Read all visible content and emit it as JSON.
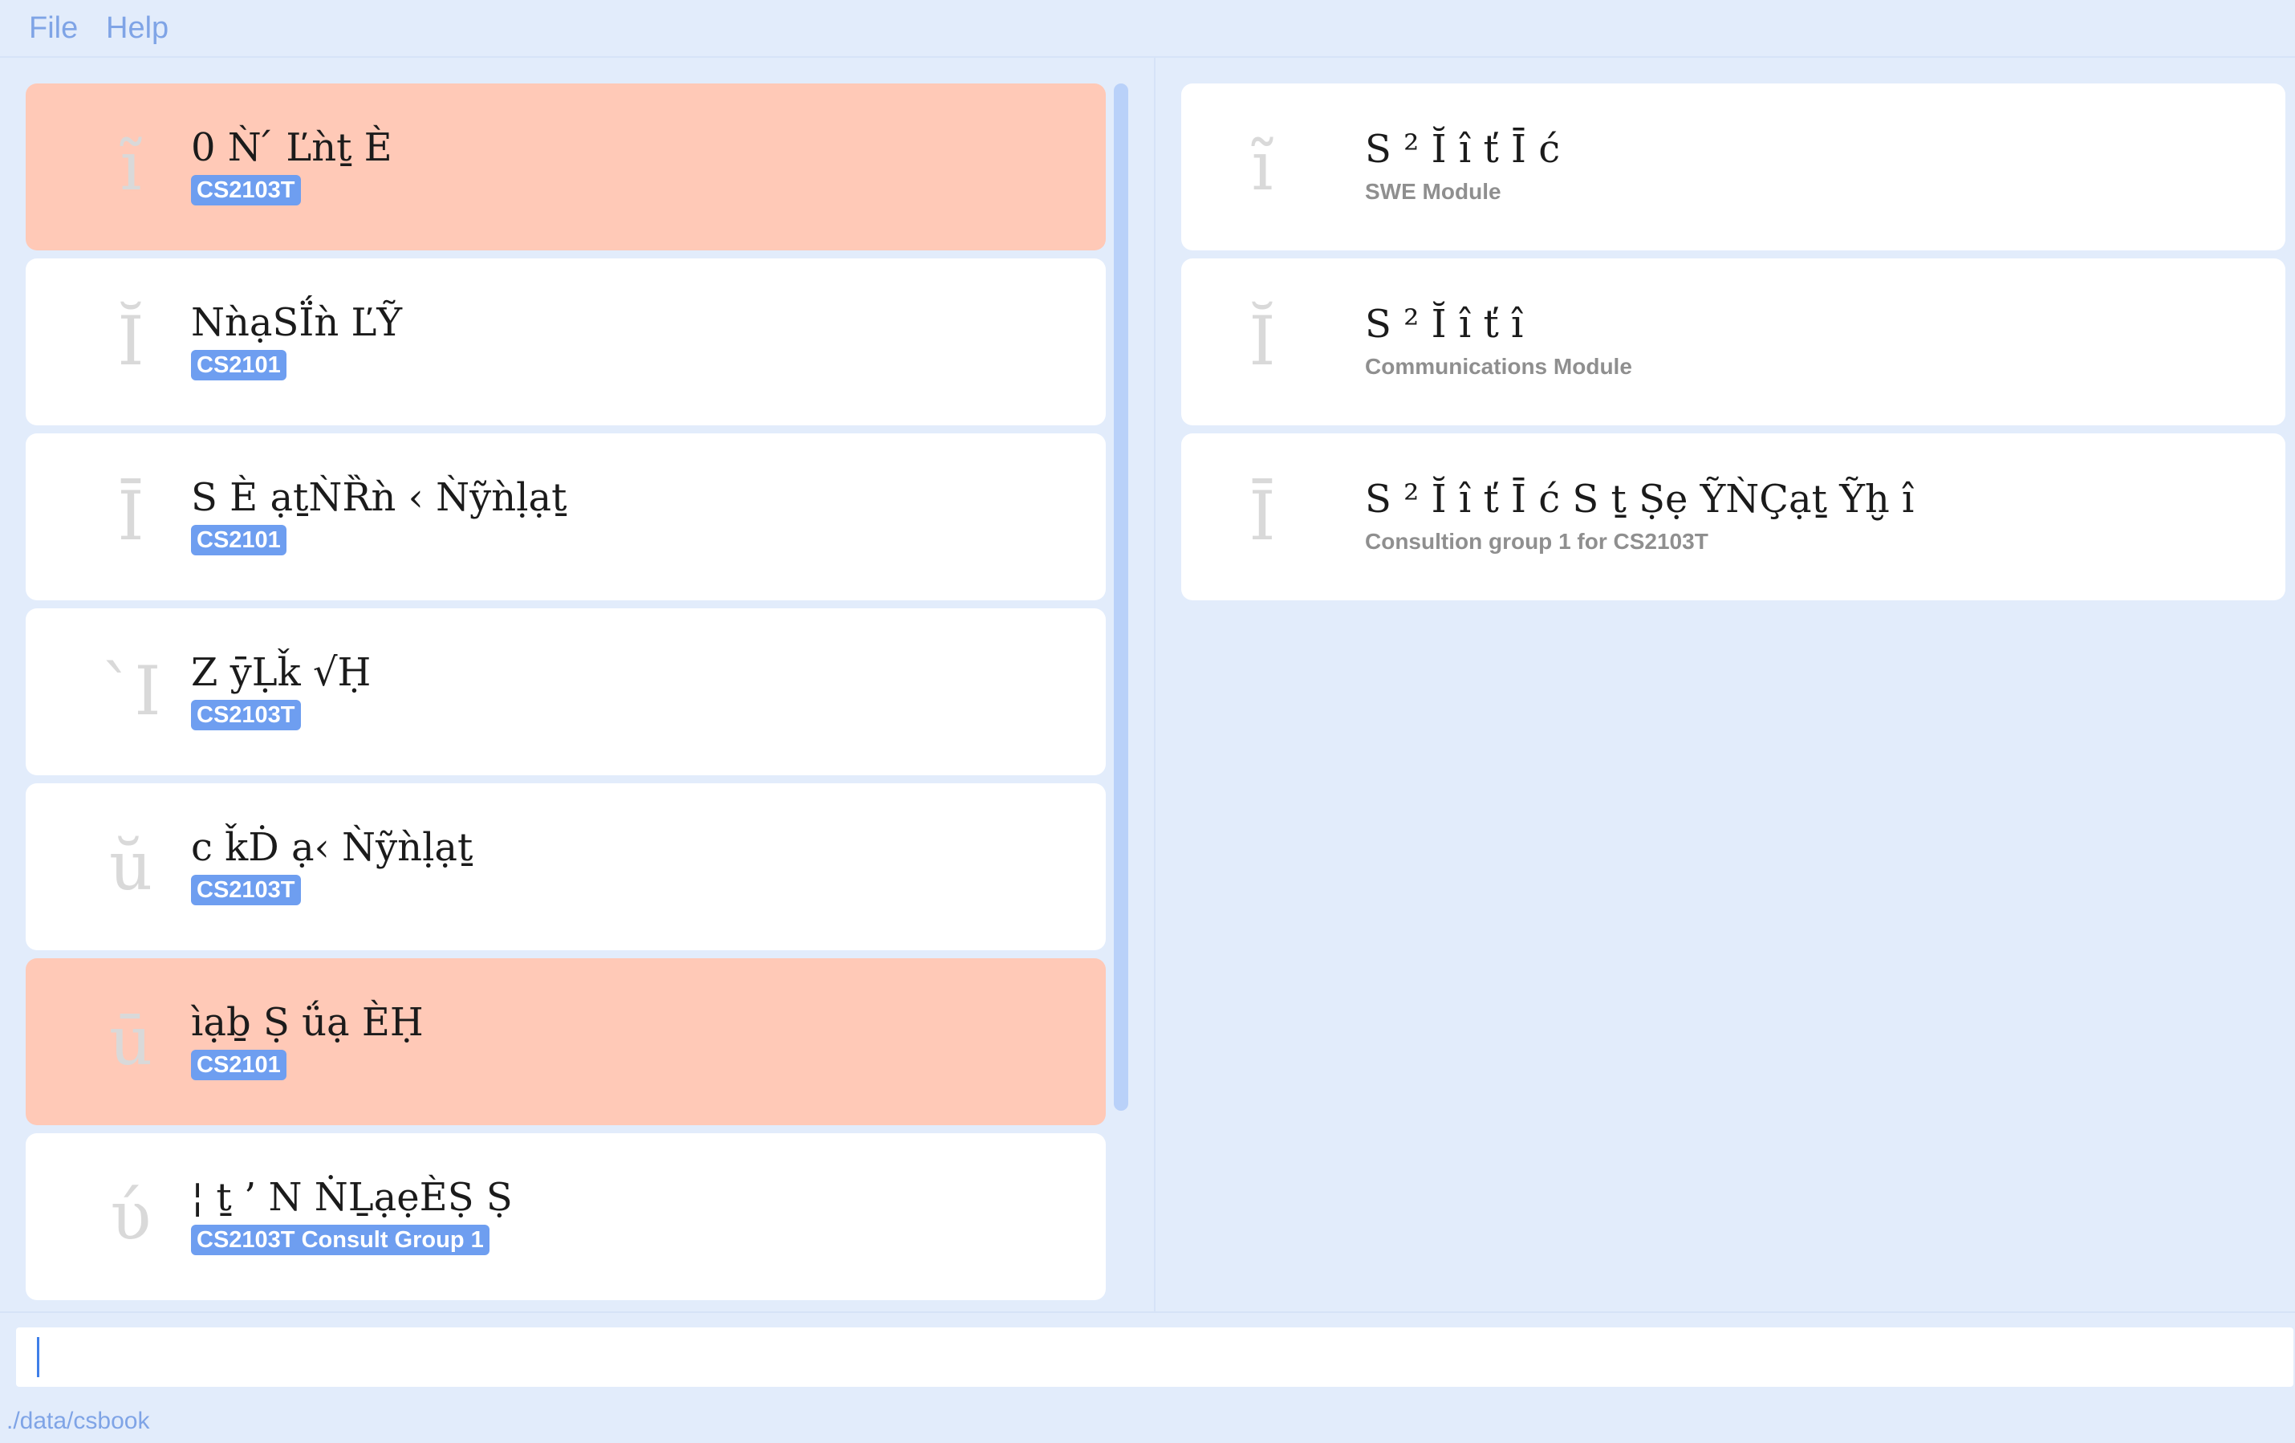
{
  "menu": {
    "file": "File",
    "help": "Help"
  },
  "left_list": {
    "items": [
      {
        "icon": "ĩ",
        "title": "0 Ǹ ́ Ľǹṯ È",
        "tag": "CS2103T",
        "highlight": true
      },
      {
        "icon": "Ĭ",
        "title": "NǹạSḮǹ ĽỸ",
        "tag": "CS2101",
        "highlight": false
      },
      {
        "icon": "Ī",
        "title": "S È ạṯǸȐǹ ‹ Ǹỹǹḷạṯ",
        "tag": "CS2101",
        "highlight": false
      },
      {
        "icon": "`I",
        "title": "Z  ȳḶǩ √Ḥ",
        "tag": "CS2103T",
        "highlight": false
      },
      {
        "icon": "ŭ",
        "title": "c ǩḊ ạ‹ Ǹỹǹḷạṯ",
        "tag": "CS2103T",
        "highlight": false
      },
      {
        "icon": "ū",
        "title": "ìạḇ Ṣ ǘạ ÈḤ",
        "tag": "CS2101",
        "highlight": true
      },
      {
        "icon": "ύ",
        "title": "¦ ṯ ’ N ṄḺạẹÈṢ Ṣ",
        "tag": "CS2103T Consult Group 1",
        "highlight": false
      }
    ]
  },
  "right_list": {
    "items": [
      {
        "icon": "ĩ",
        "title": "S ² Ĭ î ť Ī ć",
        "desc": "SWE Module"
      },
      {
        "icon": "Ĭ",
        "title": "S ² Ĭ î ť î",
        "desc": "Communications Module"
      },
      {
        "icon": "Ī",
        "title": "S ² Ĭ î ť Ī ć  S ṯ  Ṣẹ ỸǸÇạṯ  Ỹḫ î",
        "desc": "Consultion group 1 for CS2103T"
      }
    ]
  },
  "command": {
    "value": ""
  },
  "status": {
    "path": "./data/csbook"
  },
  "colors": {
    "background": "#e2ecfb",
    "card": "#ffffff",
    "highlight": "#ffc9b7",
    "tag": "#6e9ef0",
    "menu_text": "#7fa4e6"
  }
}
